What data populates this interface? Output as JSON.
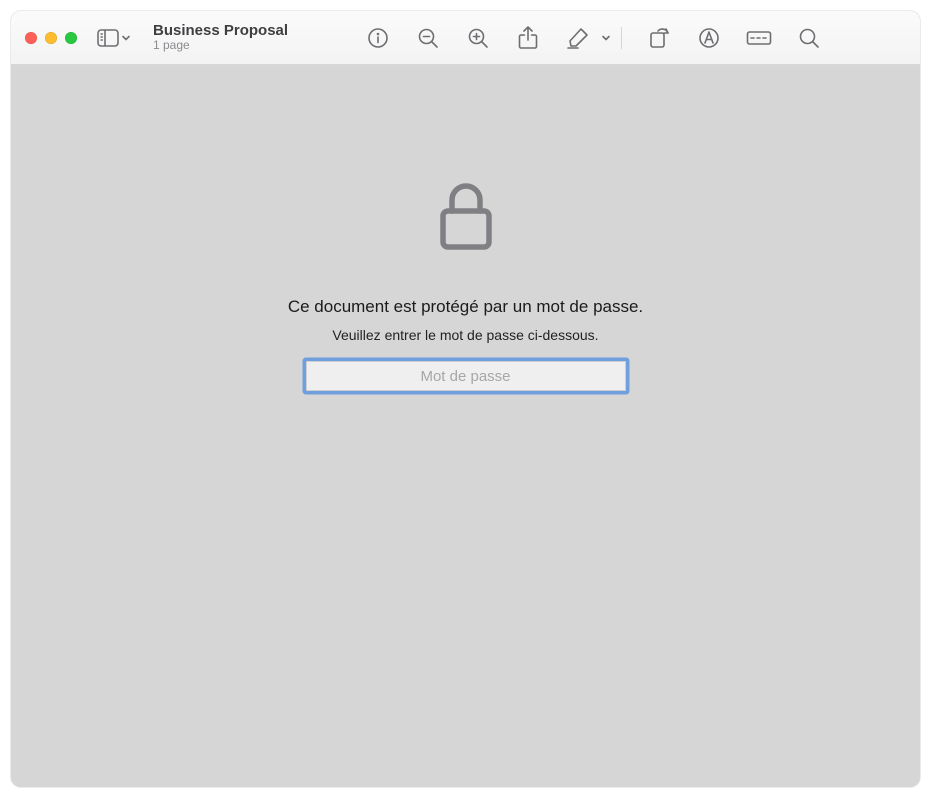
{
  "window": {
    "title": "Business Proposal",
    "subtitle": "1 page"
  },
  "toolbar": {
    "sidebar_icon": "sidebar-icon",
    "info_icon": "info-icon",
    "zoom_out_icon": "zoom-out-icon",
    "zoom_in_icon": "zoom-in-icon",
    "share_icon": "share-icon",
    "highlight_icon": "highlight-icon",
    "rotate_icon": "rotate-icon",
    "markup_icon": "markup-icon",
    "crop_icon": "crop-icon",
    "search_icon": "search-icon"
  },
  "content": {
    "heading": "Ce document est protégé par un mot de passe.",
    "subtext": "Veuillez entrer le mot de passe ci-dessous.",
    "placeholder": "Mot de passe",
    "value": ""
  }
}
